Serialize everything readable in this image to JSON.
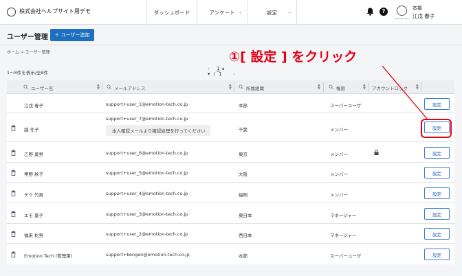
{
  "app": {
    "brand": "株式会社ヘルプサイト用デモ",
    "nav": [
      {
        "label": "ダッシュボード"
      },
      {
        "label": "アンケート"
      },
      {
        "label": "設定"
      }
    ],
    "user": {
      "dept": "本部",
      "name": "江戊 春子",
      "avatar_caption": "Emotion Tech"
    }
  },
  "page": {
    "title": "ユーザー管理",
    "add_user_label": "＋ ユーザー追加",
    "breadcrumb": "ホーム > ユーザー管理",
    "count": "1〜8件を表示/全8件",
    "pager": {
      "current": "1",
      "separator": "/",
      "total": "1"
    }
  },
  "table": {
    "columns": [
      "ユーザー名",
      "メールアドレス",
      "所属組織",
      "権限",
      "アカウントロック"
    ],
    "rows": [
      {
        "name": "江戊 春子",
        "email": "support+user_1@emotion-tech.co.jp",
        "org": "本部",
        "role": "スーパーユーザ",
        "locked": false,
        "deletable": false,
        "action": "設定"
      },
      {
        "name": "越 冬子",
        "email": "support+user_7@emotion-tech.co.jp",
        "note": "本人確認メールより確認処理を行ってください",
        "org": "千葉",
        "role": "メンバー",
        "locked": false,
        "deletable": true,
        "action": "設定"
      },
      {
        "name": "乙野 夏男",
        "email": "support+user_6@emotion-tech.co.jp",
        "org": "東京",
        "role": "メンバー",
        "locked": true,
        "deletable": true,
        "action": "設定"
      },
      {
        "name": "甲野 秋子",
        "email": "support+user_5@emotion-tech.co.jp",
        "org": "大阪",
        "role": "メンバー",
        "locked": false,
        "deletable": true,
        "action": "設定"
      },
      {
        "name": "テク 竹男",
        "email": "support+user_4@emotion-tech.co.jp",
        "org": "福岡",
        "role": "メンバー",
        "locked": false,
        "deletable": true,
        "action": "設定"
      },
      {
        "name": "エモ 夏子",
        "email": "support+user_3@emotion-tech.co.jp",
        "org": "東日本",
        "role": "マネージャー",
        "locked": false,
        "deletable": true,
        "action": "設定"
      },
      {
        "name": "福来 松男",
        "email": "support+user_2@emotion-tech.co.jp",
        "org": "西日本",
        "role": "マネージャー",
        "locked": false,
        "deletable": true,
        "action": "設定"
      },
      {
        "name": "Emotion Tech (管理用)",
        "email": "support+kengen@emotion-tech.co.jp",
        "org": "本部",
        "role": "スーパーユーザ",
        "locked": false,
        "deletable": true,
        "action": "設定"
      }
    ]
  },
  "annotation": {
    "text": "①[ 設定 ] をクリック",
    "color": "#e60012"
  },
  "colors": {
    "accent": "#1e6fbd",
    "annotation": "#e60012"
  }
}
